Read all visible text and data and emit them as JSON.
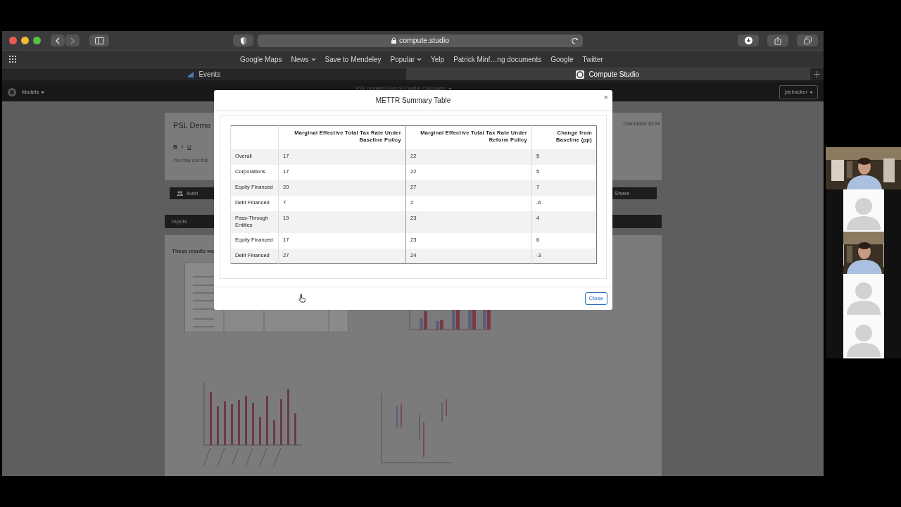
{
  "browser": {
    "url": "compute.studio",
    "bookmarks": [
      {
        "label": "Google Maps",
        "menu": false
      },
      {
        "label": "News",
        "menu": true
      },
      {
        "label": "Save to Mendeley",
        "menu": false
      },
      {
        "label": "Popular",
        "menu": true
      },
      {
        "label": "Yelp",
        "menu": false
      },
      {
        "label": "Patrick Minf…ng documents",
        "menu": false
      },
      {
        "label": "Google",
        "menu": false
      },
      {
        "label": "Twitter",
        "menu": false
      }
    ],
    "tabs": [
      {
        "label": "Events",
        "selected": false
      },
      {
        "label": "Compute Studio",
        "selected": true
      }
    ]
  },
  "page": {
    "models": "Models",
    "breadcrumb": "PSL models/Cost-of-Capital-Calculator",
    "user": "jdebacker",
    "title": "PSL Demo",
    "run_label": "Calculator #104",
    "format_buttons": [
      "B",
      "I",
      "U"
    ],
    "description": {
      "placeholder": "You may use this"
    },
    "author_button": "Auth",
    "share_button": "Share",
    "inputs_tab": "Inputs",
    "results_text": "These results we"
  },
  "modal": {
    "title": "METTR Summary Table",
    "close": "×",
    "columns": [
      "",
      "Marginal Effective Total Tax Rate Under Baseline Policy",
      "Marginal Effective Total Tax Rate Under Reform Policy",
      "Change from Baseline (pp)"
    ],
    "rows": [
      [
        "Overall",
        "17",
        "22",
        "5"
      ],
      [
        "Corporations",
        "17",
        "22",
        "5"
      ],
      [
        "Equity Financed",
        "20",
        "27",
        "7"
      ],
      [
        "Debt Financed",
        "7",
        "2",
        "-6"
      ],
      [
        "Pass-Through Entities",
        "19",
        "23",
        "4"
      ],
      [
        "Equity Financed",
        "17",
        "23",
        "6"
      ],
      [
        "Debt Financed",
        "27",
        "24",
        "-3"
      ]
    ],
    "footer_button": "Close"
  },
  "participants": [
    {
      "kind": "picture"
    },
    {
      "kind": "avatar"
    },
    {
      "kind": "picture"
    },
    {
      "kind": "avatar"
    },
    {
      "kind": "avatar"
    }
  ]
}
